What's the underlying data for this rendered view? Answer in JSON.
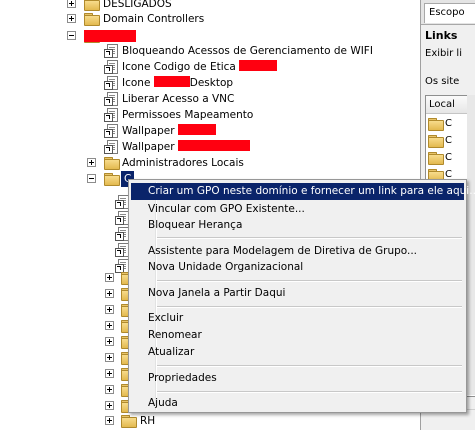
{
  "tree": {
    "desligados": "DESLIGADOS",
    "domain_controllers": "Domain Controllers",
    "gpo_links": [
      {
        "label": "Bloqueando Acessos de Gerenciamento de WIFI"
      },
      {
        "label": "Icone Codigo de Etica "
      },
      {
        "label_pre": "Icone ",
        "label_post": "Desktop"
      },
      {
        "label": "Liberar Acesso a VNC"
      },
      {
        "label": "Permissoes Mapeamento"
      },
      {
        "label": "Wallpaper "
      },
      {
        "label": "Wallpaper "
      }
    ],
    "administradores_locais": "Administradores Locais",
    "selected_ou_partial": "C",
    "last_visible_ou": "RH"
  },
  "right_pane": {
    "tab_label": "Escopo",
    "links_heading": "Links",
    "exibir_text": "Exibir li",
    "os_sites_text": "Os site",
    "column_header": "Local",
    "rows": [
      "C",
      "C",
      "C",
      "C",
      "C",
      "C",
      "C"
    ]
  },
  "context_menu": {
    "items": [
      {
        "label": "Criar um GPO neste domínio e fornecer um link para ele aqui...",
        "selected": true
      },
      {
        "label": "Vincular com GPO Existente..."
      },
      {
        "label": "Bloquear Herança"
      },
      {
        "label": "Assistente para Modelagem de Diretiva de Grupo..."
      },
      {
        "label": "Nova Unidade Organizacional"
      },
      {
        "label": "Nova Janela a Partir Daqui"
      },
      {
        "label": "Excluir"
      },
      {
        "label": "Renomear"
      },
      {
        "label": "Atualizar"
      },
      {
        "label": "Propriedades"
      },
      {
        "label": "Ajuda"
      }
    ]
  },
  "colors": {
    "menu_highlight": "#0a246a",
    "redaction": "#ff0010",
    "folder_yellow": "#e3b94f"
  }
}
